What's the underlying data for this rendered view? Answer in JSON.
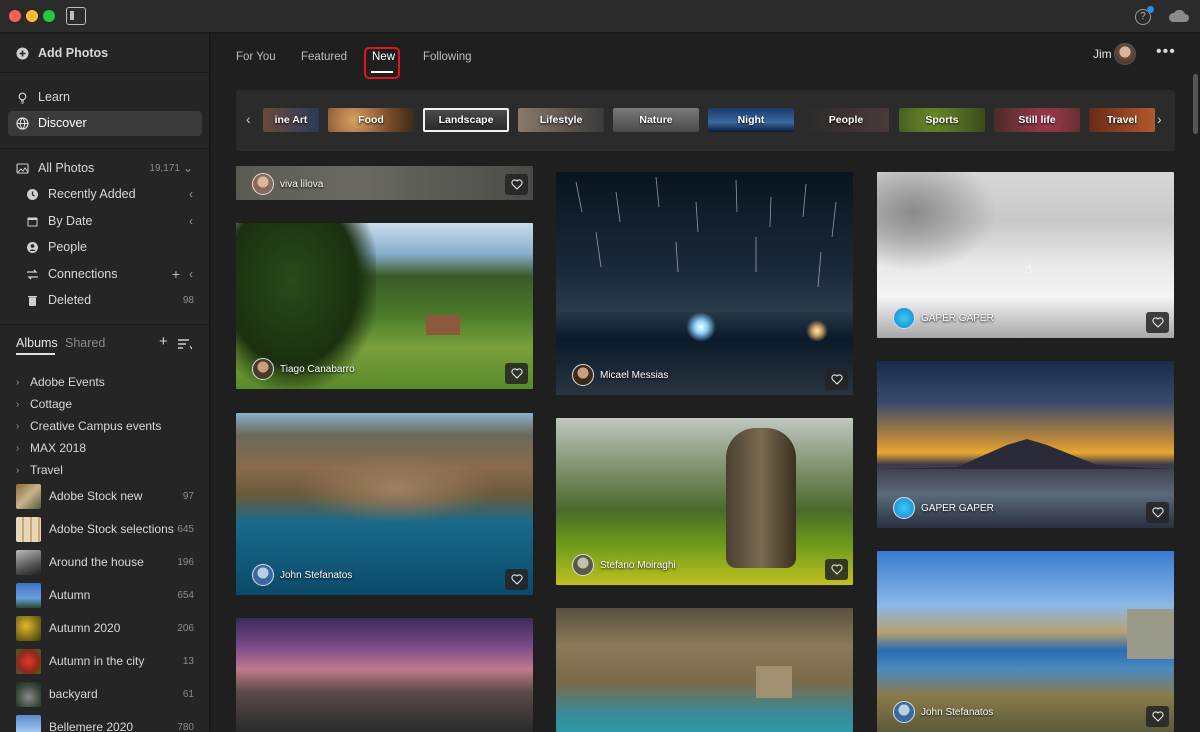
{
  "window": {
    "traffic_lights": [
      "close",
      "minimize",
      "zoom"
    ],
    "icons": [
      "panel-toggle-icon",
      "help-icon",
      "cloud-icon"
    ]
  },
  "sidebar": {
    "add_photos": "Add Photos",
    "learn": "Learn",
    "discover": "Discover",
    "all_photos": {
      "label": "All Photos",
      "count": "19,171"
    },
    "library": [
      {
        "label": "Recently Added",
        "icon": "clock-icon"
      },
      {
        "label": "By Date",
        "icon": "calendar-icon"
      },
      {
        "label": "People",
        "icon": "person-icon"
      },
      {
        "label": "Connections",
        "icon": "connections-icon"
      },
      {
        "label": "Deleted",
        "icon": "trash-icon",
        "count": "98"
      }
    ],
    "albums_tab": "Albums",
    "shared_tab": "Shared",
    "folders": [
      "Adobe Events",
      "Cottage",
      "Creative Campus events",
      "MAX 2018",
      "Travel"
    ],
    "albums": [
      {
        "label": "Adobe Stock new",
        "count": "97"
      },
      {
        "label": "Adobe Stock selections",
        "count": "645"
      },
      {
        "label": "Around the house",
        "count": "196"
      },
      {
        "label": "Autumn",
        "count": "654"
      },
      {
        "label": "Autumn 2020",
        "count": "206"
      },
      {
        "label": "Autumn in the city",
        "count": "13"
      },
      {
        "label": "backyard",
        "count": "61"
      },
      {
        "label": "Bellemere 2020",
        "count": "780"
      }
    ]
  },
  "header": {
    "tabs": [
      "For You",
      "Featured",
      "New",
      "Following"
    ],
    "active_tab": "New",
    "user_name": "Jim"
  },
  "categories": {
    "items": [
      "ine Art",
      "Food",
      "Landscape",
      "Lifestyle",
      "Nature",
      "Night",
      "People",
      "Sports",
      "Still life",
      "Travel"
    ],
    "selected": "Landscape"
  },
  "photos": {
    "col1": [
      {
        "author": "viva lilova"
      },
      {
        "author": "Tiago Canabarro"
      },
      {
        "author": "John Stefanatos"
      },
      {
        "author": ""
      }
    ],
    "col2": [
      {
        "author": "Micael Messias"
      },
      {
        "author": "Stefano Moiraghi"
      },
      {
        "author": ""
      }
    ],
    "col3": [
      {
        "author": "GAPER GAPER"
      },
      {
        "author": "GAPER GAPER"
      },
      {
        "author": "John Stefanatos"
      }
    ]
  },
  "colors": {
    "accent_highlight": "#e4141b",
    "background": "#1f1f1f",
    "sidebar": "#252525"
  }
}
